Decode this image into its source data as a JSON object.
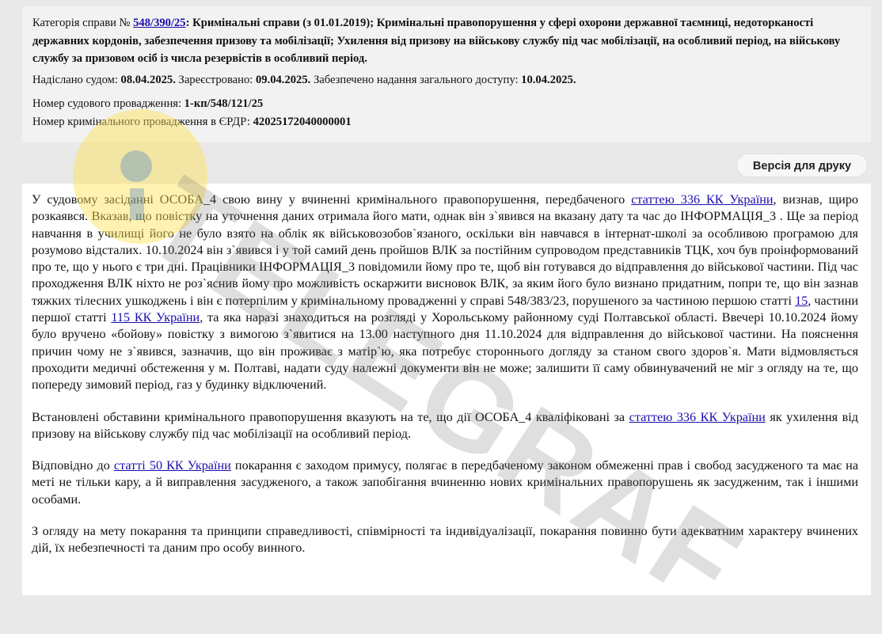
{
  "info": {
    "category_label": "Категорія справи № ",
    "category_link": "548/390/25",
    "category_text": ": Кримінальні справи (з 01.01.2019); Кримінальні правопорушення у сфері охорони державної таємниці, недоторканості державних кордонів, забезпечення призову та мобілізації; Ухилення від призову на військову службу під час мобілізації, на особливий період, на військову службу за призовом осіб із числа резервістів в особливий період.",
    "sent_label": "Надіслано судом: ",
    "sent_value": "08.04.2025.",
    "registered_label": " Зареєстровано: ",
    "registered_value": "09.04.2025.",
    "access_label": " Забезпечено надання загального доступу: ",
    "access_value": "10.04.2025.",
    "court_case_label": "Номер судового провадження: ",
    "court_case_value": "1-кп/548/121/25",
    "erdr_label": "Номер кримінального провадження в ЄРДР: ",
    "erdr_value": "42025172040000001"
  },
  "print_button": "Версія для друку",
  "watermark_text": "TELEGRAF",
  "body": {
    "p1_a": "У судовому засіданні ОСОБА_4 свою вину у вчиненні кримінального правопорушення, передбаченого ",
    "p1_link1": "статтею 336 КК України",
    "p1_b": ", визнав, щиро розкаявся. Вказав, що повістку на уточнення даних отримала його мати, однак він з`явився на вказану дату та час до ІНФОРМАЦІЯ_3 . Ще за період навчання в училищі його не було взято на облік як військовозобов`язаного, оскільки він навчався в інтернат-школі за особливою програмою для розумово відсталих. 10.10.2024 він з`явився і у той самий день пройшов ВЛК за постійним супроводом представників ТЦК, хоч був проінформований про те, що у нього є три дні. Працівники ІНФОРМАЦІЯ_3 повідомили йому про те, щоб він готувався до відправлення до військової частини. Під час проходження ВЛК ніхто не роз`яснив йому про можливість оскаржити висновок ВЛК, за яким його було визнано придатним, попри те, що він зазнав тяжких тілесних ушкоджень і він є потерпілим у кримінальному провадженні у справі 548/383/23, порушеного за частиною першою статті ",
    "p1_link2": "15",
    "p1_c": ", частини першої статті ",
    "p1_link3": "115 КК України",
    "p1_d": ", та яка наразі знаходиться на розгляді у Хорольському районному суді Полтавської області. Ввечері 10.10.2024 йому було вручено «бойову» повістку з вимогою з`явитися на 13.00 наступного дня 11.10.2024 для відправлення до військової частини. На пояснення причин чому не з`явився, зазначив, що він проживає з матір`ю, яка потребує стороннього догляду за станом свого здоров`я. Мати відмовляється проходити медичні обстеження у м. Полтаві, надати суду належні документи він не може; залишити її саму обвинувачений не міг з огляду на те, що попереду зимовий період, газ у будинку відключений.",
    "p2_a": "Встановлені обставини кримінального правопорушення вказують на те, що дії ОСОБА_4 кваліфіковані за ",
    "p2_link": "статтею 336 КК України",
    "p2_b": " як ухилення від призову на військову службу під час мобілізації на особливий період.",
    "p3_a": "Відповідно до ",
    "p3_link": "статті 50 КК України",
    "p3_b": " покарання є заходом примусу, полягає в передбаченому законом обмеженні прав і свобод засудженого та має на меті не тільки кару, а й виправлення засудженого, а також запобігання вчиненню нових кримінальних правопорушень як засудженим, так і іншими особами.",
    "p4": "З огляду на мету покарання та принципи справедливості, співмірності та індивідуалізації, покарання повинно бути адекватним характеру вчинених дій, їх небезпечності та даним про особу винного."
  }
}
